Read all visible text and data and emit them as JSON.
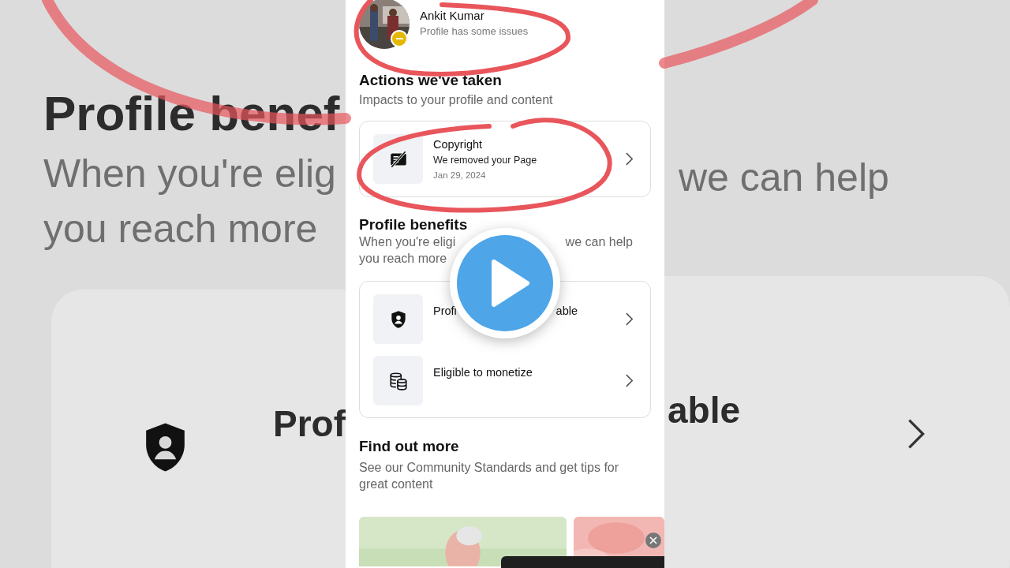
{
  "background": {
    "left": {
      "heading": "Profile benef",
      "lines": [
        "When you're elig",
        "you reach more"
      ],
      "card_title": "Prof"
    },
    "right": {
      "lines": [
        "we can help"
      ],
      "card_title": "able"
    }
  },
  "profile": {
    "name": "Ankit Kumar",
    "status": "Profile has some issues"
  },
  "actions": {
    "title": "Actions we've taken",
    "subtitle": "Impacts to your profile and content",
    "items": [
      {
        "kind": "copyright",
        "title": "Copyright",
        "detail": "We removed your Page",
        "date": "Jan 29, 2024"
      }
    ]
  },
  "benefits": {
    "title": "Profile benefits",
    "subtitle_lines": [
      [
        "When you're eligi",
        "we can help"
      ],
      [
        "you reach more"
      ]
    ],
    "items": [
      {
        "kind": "recommendable",
        "title_parts": [
          "Profi",
          "able"
        ]
      },
      {
        "kind": "monetize",
        "title_parts": [
          "Eligible to monetize"
        ]
      }
    ]
  },
  "find_out_more": {
    "title": "Find out more",
    "subtitle": "See our Community Standards and get tips for great content"
  }
}
